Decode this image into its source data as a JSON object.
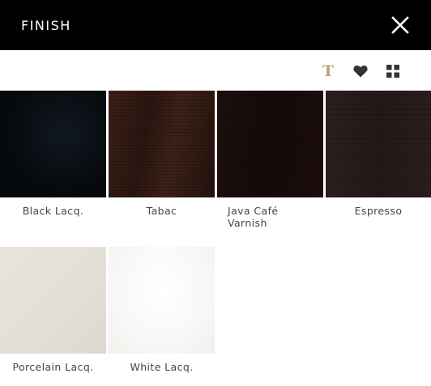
{
  "header": {
    "title": "FINISH"
  },
  "toolbar": {
    "icons": [
      "text-icon",
      "heart-icon",
      "grid-icon"
    ],
    "text_glyph": "T"
  },
  "colors": {
    "header_bg": "#000000",
    "text_icon": "#b9a27b",
    "icon_dark": "#333333"
  },
  "swatches": [
    {
      "label": "Black Lacq.",
      "color": "#070a0e"
    },
    {
      "label": "Tabac",
      "color": "#33190f"
    },
    {
      "label": "Java Café Varnish",
      "color": "#180c0a"
    },
    {
      "label": "Espresso",
      "color": "#261b1b"
    },
    {
      "label": "Porcelain Lacq.",
      "color": "#e5e1da"
    },
    {
      "label": "White Lacq.",
      "color": "#f9f8f6"
    }
  ]
}
